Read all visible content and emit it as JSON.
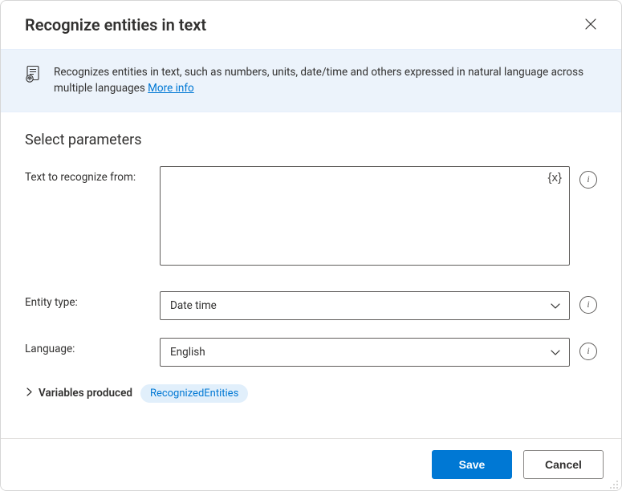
{
  "dialog": {
    "title": "Recognize entities in text",
    "banner": {
      "description": "Recognizes entities in text, such as numbers, units, date/time and others expressed in natural language across multiple languages ",
      "more_link": "More info"
    }
  },
  "section_title": "Select parameters",
  "fields": {
    "text": {
      "label": "Text to recognize from:",
      "value": "",
      "var_token": "{x}"
    },
    "entity_type": {
      "label": "Entity type:",
      "value": "Date time"
    },
    "language": {
      "label": "Language:",
      "value": "English"
    }
  },
  "variables_produced": {
    "label": "Variables produced",
    "chip": "RecognizedEntities"
  },
  "footer": {
    "save": "Save",
    "cancel": "Cancel"
  },
  "info_tooltip_glyph": "i"
}
